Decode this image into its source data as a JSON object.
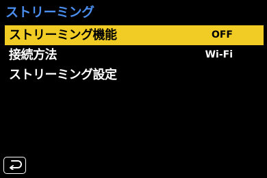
{
  "header": {
    "title": "ストリーミング"
  },
  "menu": {
    "items": [
      {
        "label": "ストリーミング機能",
        "value": "OFF",
        "selected": true
      },
      {
        "label": "接続方法",
        "value": "Wi-Fi",
        "selected": false
      },
      {
        "label": "ストリーミング設定",
        "value": "",
        "selected": false
      }
    ]
  },
  "footer": {
    "back_icon": "return-arrow-icon"
  },
  "colors": {
    "background": "#000000",
    "title": "#4a8ff0",
    "highlight": "#f0cc25",
    "text": "#ffffff"
  }
}
